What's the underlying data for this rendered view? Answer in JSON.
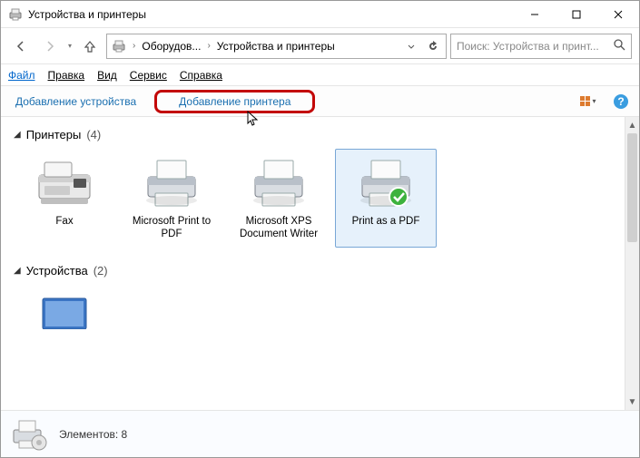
{
  "window": {
    "title": "Устройства и принтеры"
  },
  "address": {
    "crumb1": "Оборудов...",
    "crumb2": "Устройства и принтеры"
  },
  "search": {
    "placeholder": "Поиск: Устройства и принт..."
  },
  "menu": {
    "file": "Файл",
    "edit": "Правка",
    "view": "Вид",
    "service": "Сервис",
    "help": "Справка"
  },
  "commands": {
    "add_device": "Добавление устройства",
    "add_printer": "Добавление принтера"
  },
  "sections": {
    "printers": {
      "label": "Принтеры",
      "count": "(4)"
    },
    "devices": {
      "label": "Устройства",
      "count": "(2)"
    }
  },
  "printers": [
    {
      "name": "Fax",
      "type": "fax"
    },
    {
      "name": "Microsoft Print to PDF",
      "type": "printer"
    },
    {
      "name": "Microsoft XPS Document Writer",
      "type": "printer"
    },
    {
      "name": "Print as a PDF",
      "type": "printer_default"
    }
  ],
  "status": {
    "label": "Элементов:",
    "count": "8"
  }
}
